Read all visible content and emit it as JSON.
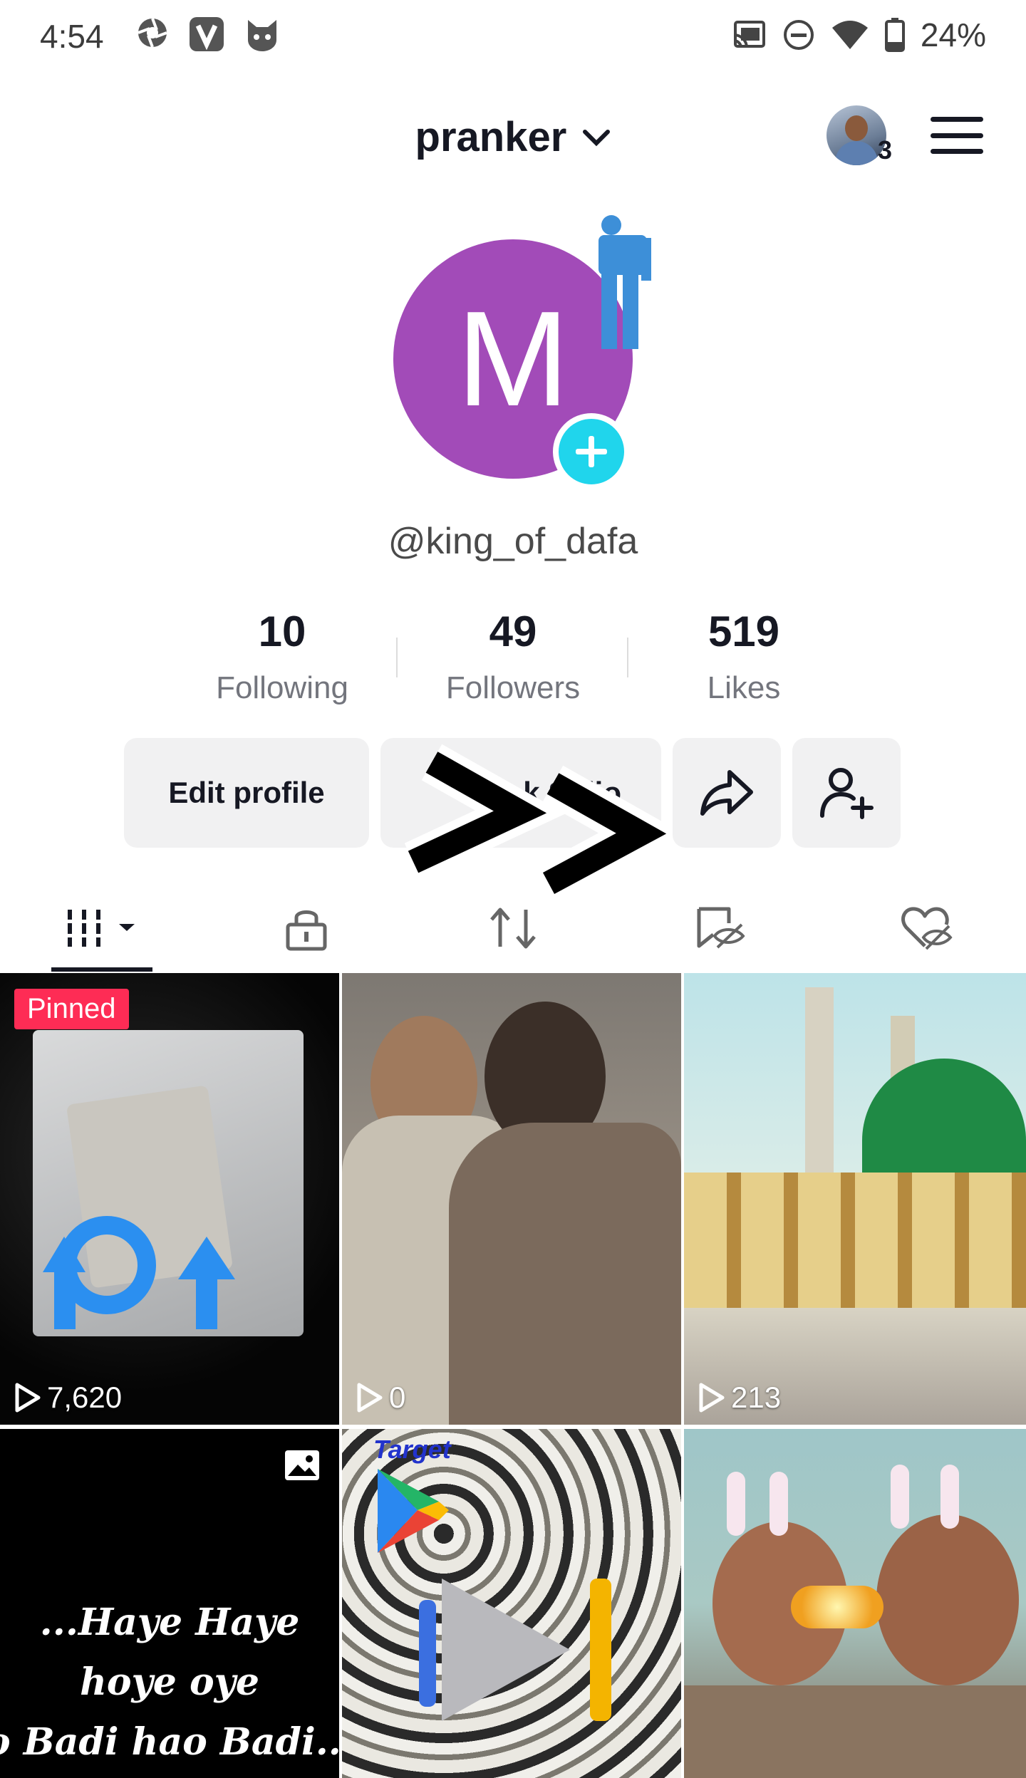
{
  "status_bar": {
    "time": "4:54",
    "battery": "24%",
    "left_icons": [
      "aperture-icon",
      "v-app-icon",
      "cat-app-icon"
    ],
    "right_icons": [
      "cast-icon",
      "do-not-disturb-icon",
      "wifi-icon",
      "battery-icon"
    ]
  },
  "header": {
    "account_name": "pranker",
    "account_count": "3"
  },
  "profile": {
    "avatar_letter": "M",
    "avatar_color": "#a24bb8",
    "username": "@king_of_dafa"
  },
  "stats": [
    {
      "value": "10",
      "label": "Following"
    },
    {
      "value": "49",
      "label": "Followers"
    },
    {
      "value": "519",
      "label": "Likes"
    }
  ],
  "actions": {
    "edit_profile": "Edit profile",
    "studio": "k St  lio"
  },
  "tabs": [
    "videos-tab",
    "private-tab",
    "reposts-tab",
    "favorites-tab",
    "liked-tab"
  ],
  "grid": [
    {
      "views": "7,620",
      "pinned": "Pinned"
    },
    {
      "views": "0"
    },
    {
      "views": "213"
    },
    {
      "caption_lines": [
        "...Haye Haye",
        "hoye oye",
        "o Badi hao Badi..."
      ]
    },
    {
      "label": "Target"
    },
    {
      "label": ""
    }
  ],
  "colors": {
    "accent_red": "#fe2c55",
    "accent_cyan": "#20d5ec",
    "button_bg": "#f1f1f2"
  }
}
